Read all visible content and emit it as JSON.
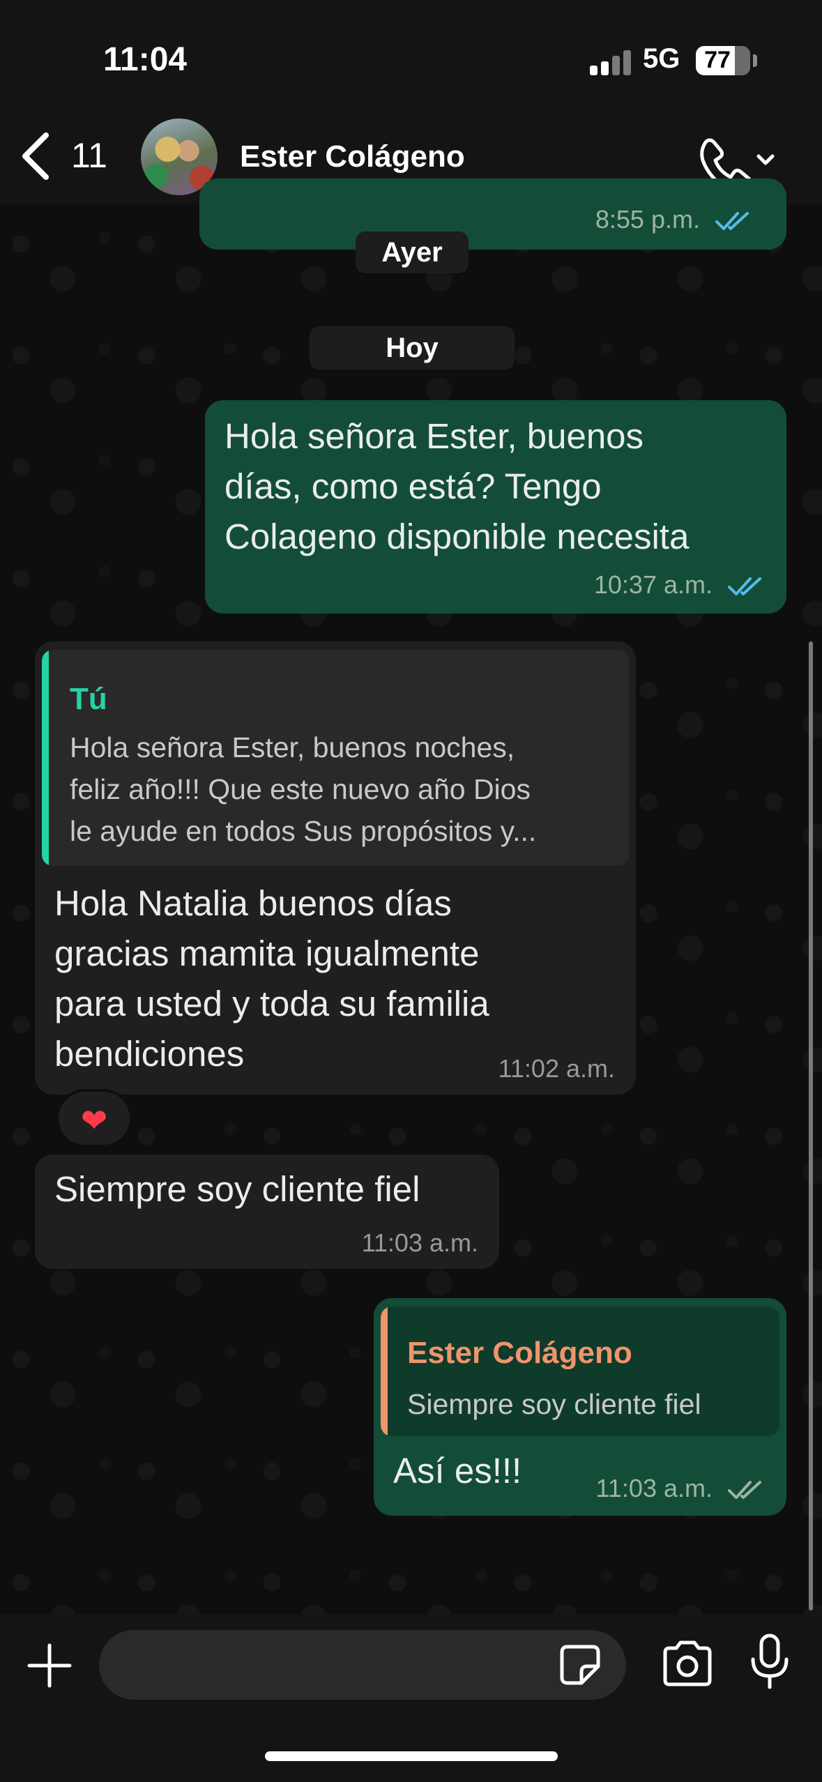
{
  "status_bar": {
    "time": "11:04",
    "network": "5G",
    "battery": "77"
  },
  "header": {
    "back_count": "11",
    "contact_name": "Ester Colágeno"
  },
  "colors": {
    "outgoing_bubble": "#144d37",
    "incoming_bubble": "#1f1f1f",
    "read_ticks": "#53bdeb",
    "reply_accent_you": "#25d3a6",
    "reply_accent_contact": "#f0946c"
  },
  "dates": {
    "yesterday": "Ayer",
    "today": "Hoy"
  },
  "messages": [
    {
      "direction": "out",
      "time": "8:55 p.m.",
      "status": "read"
    },
    {
      "direction": "out",
      "lines": [
        "Hola señora Ester, buenos",
        "días, como está? Tengo",
        "Colageno disponible necesita"
      ],
      "time": "10:37 a.m.",
      "status": "read"
    },
    {
      "direction": "in",
      "reply_to": {
        "author": "Tú",
        "lines": [
          "Hola señora Ester, buenos noches,",
          "feliz año!!! Que este nuevo año Dios",
          "le ayude en todos Sus propósitos y..."
        ]
      },
      "lines": [
        "Hola Natalia buenos días",
        "gracias mamita igualmente",
        "para usted y toda su familia",
        "bendiciones"
      ],
      "time": "11:02 a.m.",
      "reaction": "❤"
    },
    {
      "direction": "in",
      "lines": [
        "Siempre soy cliente fiel"
      ],
      "time": "11:03 a.m."
    },
    {
      "direction": "out",
      "reply_to": {
        "author": "Ester Colágeno",
        "lines": [
          "Siempre soy cliente fiel"
        ]
      },
      "lines": [
        "Así es!!!"
      ],
      "time": "11:03 a.m.",
      "status": "delivered"
    }
  ],
  "composer": {
    "plus_icon": "plus-icon",
    "sticker_icon": "sticker-icon",
    "camera_icon": "camera-icon",
    "mic_icon": "microphone-icon"
  }
}
